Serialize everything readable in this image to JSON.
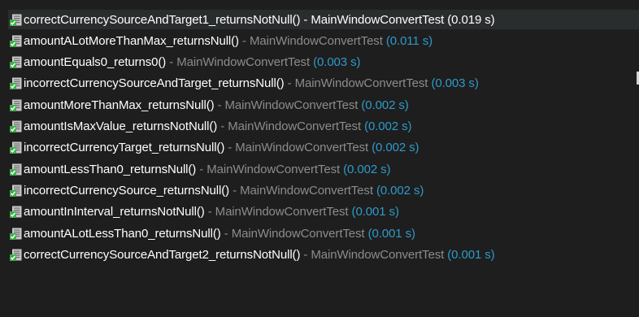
{
  "test_results": {
    "separator": " - ",
    "rows": [
      {
        "name": "correctCurrencySourceAndTarget1_returnsNotNull()",
        "suite": "MainWindowConvertTest",
        "time": "(0.019 s)",
        "icon": "test-passed-icon",
        "selected": true
      },
      {
        "name": "amountALotMoreThanMax_returnsNull()",
        "suite": "MainWindowConvertTest",
        "time": "(0.011 s)",
        "icon": "test-passed-icon",
        "selected": false
      },
      {
        "name": "amountEquals0_returns0()",
        "suite": "MainWindowConvertTest",
        "time": "(0.003 s)",
        "icon": "test-passed-icon",
        "selected": false
      },
      {
        "name": "incorrectCurrencySourceAndTarget_returnsNull()",
        "suite": "MainWindowConvertTest",
        "time": "(0.003 s)",
        "icon": "test-passed-icon",
        "selected": false
      },
      {
        "name": "amountMoreThanMax_returnsNull()",
        "suite": "MainWindowConvertTest",
        "time": "(0.002 s)",
        "icon": "test-passed-icon",
        "selected": false
      },
      {
        "name": "amountIsMaxValue_returnsNotNull()",
        "suite": "MainWindowConvertTest",
        "time": "(0.002 s)",
        "icon": "test-passed-icon",
        "selected": false
      },
      {
        "name": "incorrectCurrencyTarget_returnsNull()",
        "suite": "MainWindowConvertTest",
        "time": "(0.002 s)",
        "icon": "test-passed-icon",
        "selected": false
      },
      {
        "name": "amountLessThan0_returnsNull()",
        "suite": "MainWindowConvertTest",
        "time": "(0.002 s)",
        "icon": "test-passed-icon",
        "selected": false
      },
      {
        "name": "incorrectCurrencySource_returnsNull()",
        "suite": "MainWindowConvertTest",
        "time": "(0.002 s)",
        "icon": "test-passed-icon",
        "selected": false
      },
      {
        "name": "amountInInterval_returnsNotNull()",
        "suite": "MainWindowConvertTest",
        "time": "(0.001 s)",
        "icon": "test-passed-icon",
        "selected": false
      },
      {
        "name": "amountALotLessThan0_returnsNull()",
        "suite": "MainWindowConvertTest",
        "time": "(0.001 s)",
        "icon": "test-passed-icon",
        "selected": false
      },
      {
        "name": "correctCurrencySourceAndTarget2_returnsNotNull()",
        "suite": "MainWindowConvertTest",
        "time": "(0.001 s)",
        "icon": "test-passed-icon",
        "selected": false
      }
    ]
  },
  "colors": {
    "background": "#1e1e1e",
    "test_name": "#ffffff",
    "suite_name": "#8c8c8c",
    "duration": "#2e9ac9",
    "icon_green": "#3fae49",
    "icon_sheet": "#c8c8c8"
  }
}
